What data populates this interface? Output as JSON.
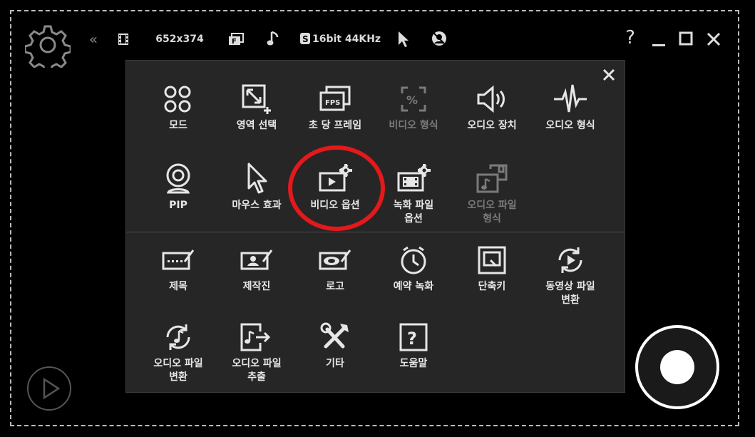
{
  "topbar": {
    "resolution": "652x374",
    "audio_format": "16bit 44KHz",
    "help": "?"
  },
  "menu": {
    "top_section": [
      {
        "label": "모드",
        "icon": "grid-circles-icon",
        "enabled": true
      },
      {
        "label": "영역 선택",
        "icon": "area-select-icon",
        "enabled": true
      },
      {
        "label": "초 당 프레임",
        "icon": "fps-icon",
        "enabled": true
      },
      {
        "label": "비디오 형식",
        "icon": "video-format-icon",
        "enabled": false
      },
      {
        "label": "오디오 장치",
        "icon": "speaker-icon",
        "enabled": true
      },
      {
        "label": "오디오 형식",
        "icon": "waveform-icon",
        "enabled": true
      },
      {
        "label": "PIP",
        "icon": "webcam-icon",
        "enabled": true
      },
      {
        "label": "마우스 효과",
        "icon": "cursor-icon",
        "enabled": true
      },
      {
        "label": "비디오 옵션",
        "icon": "video-options-icon",
        "enabled": true
      },
      {
        "label": "녹화 파일\n옵션",
        "icon": "record-file-options-icon",
        "enabled": true
      },
      {
        "label": "오디오 파일\n형식",
        "icon": "audio-file-format-icon",
        "enabled": false
      }
    ],
    "bottom_section": [
      {
        "label": "제목",
        "icon": "title-icon"
      },
      {
        "label": "제작진",
        "icon": "credits-icon"
      },
      {
        "label": "로고",
        "icon": "logo-icon"
      },
      {
        "label": "예약 녹화",
        "icon": "clock-icon"
      },
      {
        "label": "단축키",
        "icon": "hotkey-icon"
      },
      {
        "label": "동영상 파일\n변환",
        "icon": "video-convert-icon"
      },
      {
        "label": "오디오 파일\n변환",
        "icon": "audio-convert-icon"
      },
      {
        "label": "오디오 파일\n추출",
        "icon": "audio-extract-icon"
      },
      {
        "label": "기타",
        "icon": "tools-icon"
      },
      {
        "label": "도움말",
        "icon": "help-icon"
      }
    ]
  },
  "colors": {
    "accent_highlight": "#e3191b",
    "disabled": "#7a7a7a"
  }
}
